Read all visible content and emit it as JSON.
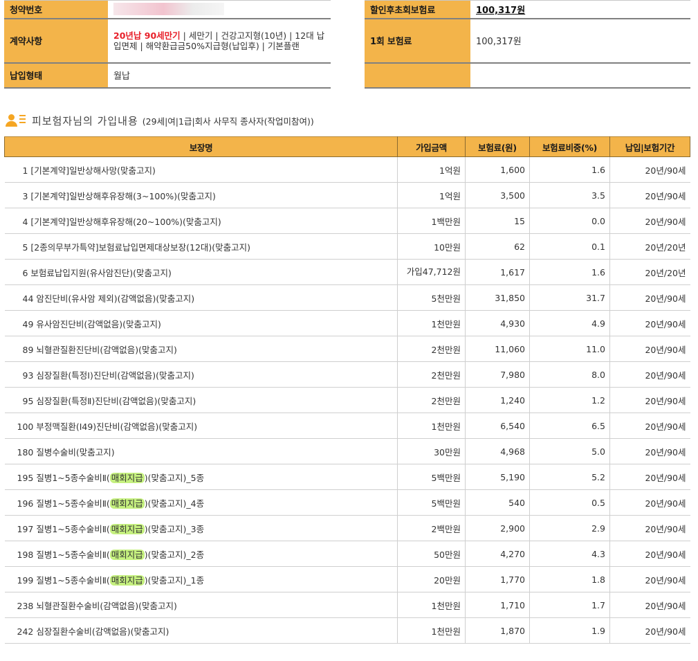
{
  "summary_left": {
    "application_no_label": "청약번호",
    "contract_label": "계약사항",
    "contract_highlight": "20년납 90세만기",
    "contract_rest": " | 세만기 | 건강고지형(10년) | 12대 납입면제 | 해약환급금50%지급형(납입후) | 기본플랜",
    "payment_type_label": "납입형태",
    "payment_type_value": "월납"
  },
  "summary_right": {
    "discount_first_label": "할인후초회보험료",
    "discount_first_value": "100,317원",
    "first_premium_label": "1회 보험료",
    "first_premium_value": "100,317원"
  },
  "section": {
    "title": "피보험자님의 가입내용",
    "subtitle": "(29세|여|1급|회사 사무직 종사자(작업미참여))"
  },
  "coverage": {
    "headers": [
      "보장명",
      "가입금액",
      "보험료(원)",
      "보험료비중(%)",
      "납입|보험기간"
    ],
    "highlight_term": "매회지급",
    "rows": [
      {
        "name": "1 [기본계약]일반상해사망(맞춤고지)",
        "amount": "1억원",
        "premium": "1,600",
        "share": "1.6",
        "period": "20년/90세"
      },
      {
        "name": "3 [기본계약]일반상해후유장해(3~100%)(맞춤고지)",
        "amount": "1억원",
        "premium": "3,500",
        "share": "3.5",
        "period": "20년/90세"
      },
      {
        "name": "4 [기본계약]일반상해후유장해(20~100%)(맞춤고지)",
        "amount": "1백만원",
        "premium": "15",
        "share": "0.0",
        "period": "20년/90세"
      },
      {
        "name": "5 [2종의무부가특약]보험료납입면제대상보장(12대)(맞춤고지)",
        "amount": "10만원",
        "premium": "62",
        "share": "0.1",
        "period": "20년/20년"
      },
      {
        "name": "6 보험료납입지원(유사암진단)(맞춤고지)",
        "amount": "가입47,712원",
        "premium": "1,617",
        "share": "1.6",
        "period": "20년/20년"
      },
      {
        "name": "44 암진단비(유사암 제외)(감액없음)(맞춤고지)",
        "amount": "5천만원",
        "premium": "31,850",
        "share": "31.7",
        "period": "20년/90세"
      },
      {
        "name": "49 유사암진단비(감액없음)(맞춤고지)",
        "amount": "1천만원",
        "premium": "4,930",
        "share": "4.9",
        "period": "20년/90세"
      },
      {
        "name": "89 뇌혈관질환진단비(감액없음)(맞춤고지)",
        "amount": "2천만원",
        "premium": "11,060",
        "share": "11.0",
        "period": "20년/90세"
      },
      {
        "name": "93 심장질환(특정Ⅰ)진단비(감액없음)(맞춤고지)",
        "amount": "2천만원",
        "premium": "7,980",
        "share": "8.0",
        "period": "20년/90세"
      },
      {
        "name": "95 심장질환(특정Ⅱ)진단비(감액없음)(맞춤고지)",
        "amount": "2천만원",
        "premium": "1,240",
        "share": "1.2",
        "period": "20년/90세"
      },
      {
        "name": "100 부정맥질환(Ⅰ49)진단비(감액없음)(맞춤고지)",
        "amount": "1천만원",
        "premium": "6,540",
        "share": "6.5",
        "period": "20년/90세"
      },
      {
        "name": "180 질병수술비(맞춤고지)",
        "amount": "30만원",
        "premium": "4,968",
        "share": "5.0",
        "period": "20년/90세"
      },
      {
        "name": "195 질병1~5종수술비Ⅱ(매회지급)(맞춤고지)_5종",
        "amount": "5백만원",
        "premium": "5,190",
        "share": "5.2",
        "period": "20년/90세"
      },
      {
        "name": "196 질병1~5종수술비Ⅱ(매회지급)(맞춤고지)_4종",
        "amount": "5백만원",
        "premium": "540",
        "share": "0.5",
        "period": "20년/90세"
      },
      {
        "name": "197 질병1~5종수술비Ⅱ(매회지급)(맞춤고지)_3종",
        "amount": "2백만원",
        "premium": "2,900",
        "share": "2.9",
        "period": "20년/90세"
      },
      {
        "name": "198 질병1~5종수술비Ⅱ(매회지급)(맞춤고지)_2종",
        "amount": "50만원",
        "premium": "4,270",
        "share": "4.3",
        "period": "20년/90세"
      },
      {
        "name": "199 질병1~5종수술비Ⅱ(매회지급)(맞춤고지)_1종",
        "amount": "20만원",
        "premium": "1,770",
        "share": "1.8",
        "period": "20년/90세"
      },
      {
        "name": "238 뇌혈관질환수술비(감액없음)(맞춤고지)",
        "amount": "1천만원",
        "premium": "1,710",
        "share": "1.7",
        "period": "20년/90세"
      },
      {
        "name": "242 심장질환수술비(감액없음)(맞춤고지)",
        "amount": "1천만원",
        "premium": "1,870",
        "share": "1.9",
        "period": "20년/90세"
      }
    ]
  }
}
